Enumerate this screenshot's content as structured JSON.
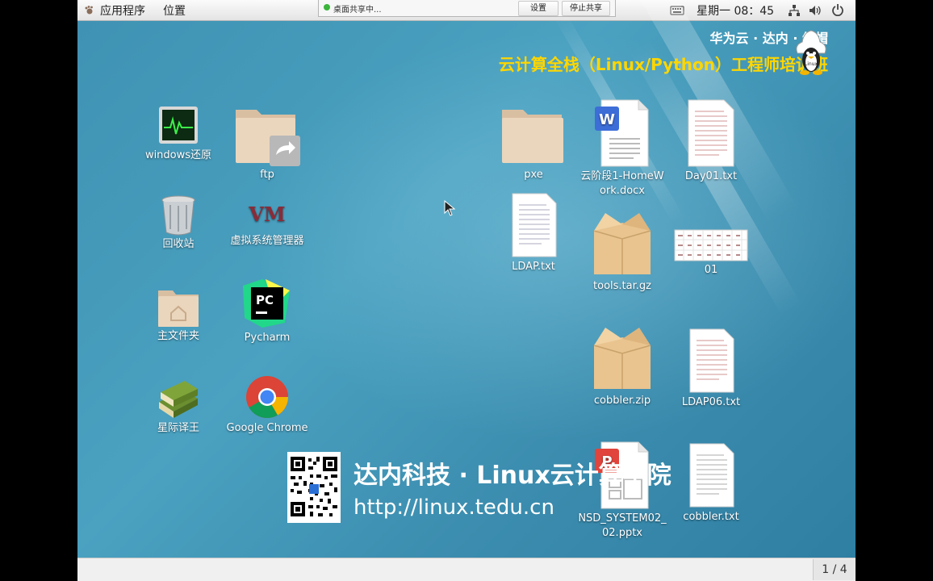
{
  "topbar": {
    "apps_menu": "应用程序",
    "places_menu": "位置",
    "share_status": "桌面共享中...",
    "settings_button": "设置",
    "stop_share_button": "停止共享",
    "clock": "星期一 08：45"
  },
  "branding": {
    "line1": "华为云 · 达内 · 红帽",
    "line2": "云计算全栈（Linux/Python）工程师培训班",
    "penguin_text": "Linux"
  },
  "desktop_icons": {
    "windows_restore": "windows还原",
    "ftp": "ftp",
    "trash": "回收站",
    "virt_manager": "虚拟系统管理器",
    "vm_logo_text": "VM",
    "home": "主文件夹",
    "pycharm": "Pycharm",
    "pycharm_logo_text": "PC",
    "star_translator": "星际译王",
    "chrome": "Google Chrome",
    "pxe": "pxe",
    "homework_docx": "云阶段1-HomeWork.docx",
    "docx_badge": "W",
    "day01_txt": "Day01.txt",
    "ldap_txt": "LDAP.txt",
    "tools_tar_gz": "tools.tar.gz",
    "file_01": "01",
    "cobbler_zip": "cobbler.zip",
    "ldap06_txt": "LDAP06.txt",
    "pptx": "NSD_SYSTEM02_02.pptx",
    "pptx_badge": "P",
    "cobbler_txt": "cobbler.txt"
  },
  "watermark": {
    "title": "达内科技 · Linux云计算学院",
    "url": "http://linux.tedu.cn"
  },
  "bottombar": {
    "workspace_pager": "1 / 4"
  },
  "colors": {
    "desktop_bg": "#3d8fb0",
    "brand_yellow": "#ffd600",
    "folder": "#e8d2b6",
    "box": "#e9c48f"
  }
}
